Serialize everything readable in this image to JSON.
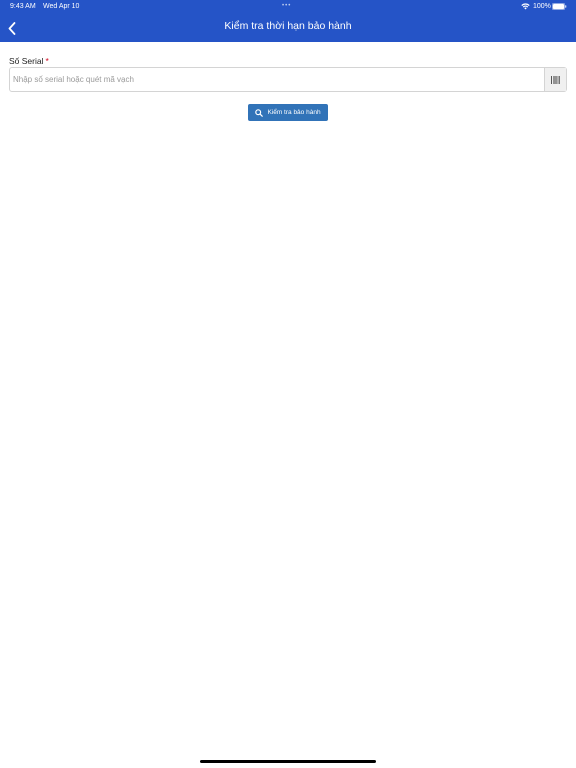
{
  "status_bar": {
    "time": "9:43 AM",
    "date": "Wed Apr 10",
    "dots": "•••",
    "battery": "100%",
    "wifi_icon": "wifi-icon",
    "battery_icon": "battery-icon"
  },
  "header": {
    "title": "Kiểm tra thời hạn bảo hành",
    "back_icon": "chevron-left-icon",
    "background_color": "#2554c7"
  },
  "form": {
    "serial_label": "Số Serial",
    "required_mark": "*",
    "serial_value": "",
    "serial_placeholder": "Nhập số serial hoặc quét mã vạch",
    "scan_icon": "barcode-icon",
    "check_button_label": "Kiểm tra bảo hành",
    "check_button_icon": "search-icon",
    "check_button_color": "#3173b8"
  }
}
